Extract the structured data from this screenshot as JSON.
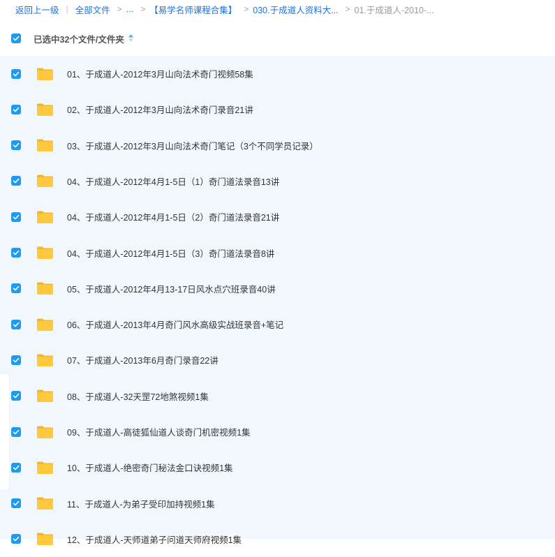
{
  "breadcrumb": {
    "back": "返回上一级",
    "all_files": "全部文件",
    "ellipsis": "...",
    "folder1": "【易学名师课程合集】",
    "folder2": "030.于成道人资料大...",
    "current": "01.于成道人-2010-..."
  },
  "selection": {
    "label": "已选中32个文件/文件夹"
  },
  "colors": {
    "accent": "#1e9bf0",
    "list_bg": "#f1f8fd",
    "folder": "#ffc83d"
  },
  "files": [
    {
      "name": "01、于成道人-2012年3月山向法术奇门视频58集",
      "icon": "folder-icon",
      "checked": true
    },
    {
      "name": "02、于成道人-2012年3月山向法术奇门录音21讲",
      "icon": "folder-icon",
      "checked": true
    },
    {
      "name": "03、于成道人-2012年3月山向法术奇门笔记（3个不同学员记录）",
      "icon": "folder-icon",
      "checked": true
    },
    {
      "name": "04、于成道人-2012年4月1-5日（1）奇门道法录音13讲",
      "icon": "folder-icon",
      "checked": true
    },
    {
      "name": "04、于成道人-2012年4月1-5日（2）奇门道法录音21讲",
      "icon": "folder-icon",
      "checked": true
    },
    {
      "name": "04、于成道人-2012年4月1-5日（3）奇门道法录音8讲",
      "icon": "folder-icon",
      "checked": true
    },
    {
      "name": "05、于成道人-2012年4月13-17日风水点穴班录音40讲",
      "icon": "folder-icon",
      "checked": true
    },
    {
      "name": "06、于成道人-2013年4月奇门风水高级实战班录音+笔记",
      "icon": "folder-icon",
      "checked": true
    },
    {
      "name": "07、于成道人-2013年6月奇门录音22讲",
      "icon": "folder-icon",
      "checked": true
    },
    {
      "name": "08、于成道人-32天罡72地煞视频1集",
      "icon": "folder-icon",
      "checked": true
    },
    {
      "name": "09、于成道人-高徒狐仙道人谈奇门机密视频1集",
      "icon": "folder-icon",
      "checked": true
    },
    {
      "name": "10、于成道人-绝密奇门秘法金口诀视频1集",
      "icon": "folder-icon",
      "checked": true
    },
    {
      "name": "11、于成道人-为弟子受印加持视频1集",
      "icon": "folder-icon",
      "checked": true
    },
    {
      "name": "12、于成道人-天师道弟子问道天师府视频1集",
      "icon": "folder-icon",
      "checked": true
    }
  ]
}
